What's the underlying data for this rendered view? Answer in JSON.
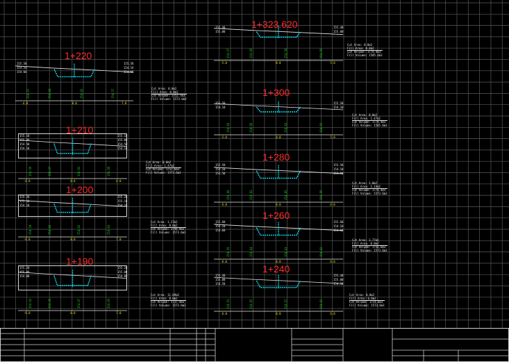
{
  "drawing": {
    "background": "#000000",
    "grid_color": "#5a5a5a",
    "title_color": "#ff2a2a",
    "profile_color": "#00e5ff",
    "label_color": "#19d219",
    "axis_color": "#e6e600"
  },
  "sections": [
    {
      "station": "1+220",
      "elev_left": [
        "155.58",
        "154.54",
        "154.66"
      ],
      "elev_right": [
        "155.58",
        "154.54",
        "154.66"
      ],
      "labels": [
        "154.57",
        "154.64",
        "154.62",
        "154.57"
      ],
      "axis": [
        "-4.0",
        "0.0",
        "7.0"
      ],
      "info": [
        "Cut Area: 0.0m2",
        "Fill Area: 0.0m2",
        "Cut Volume: 1752.7m3",
        "Fill Volume: 1573.6m3"
      ]
    },
    {
      "station": "1+210",
      "elev_left": [
        "155.10",
        "155.00",
        "154.50",
        "154.10"
      ],
      "elev_right": [
        "155.10",
        "155.00",
        "154.50",
        "154.10"
      ],
      "labels": [
        "154.50",
        "154.57",
        "154.62",
        "154.60"
      ],
      "axis": [
        "-6.0",
        "0.0",
        "6.0"
      ],
      "info": [
        "Cut Area: 0.0m2",
        "Fill Area: 1.47m2",
        "Cut Volume: 1752.6m3",
        "Fill Volume: 1573.6m3"
      ]
    },
    {
      "station": "1+200",
      "elev_left": [
        "155.20",
        "155.10",
        "154.10"
      ],
      "elev_right": [
        "155.20",
        "155.10",
        "154.10"
      ],
      "labels": [
        "154.54",
        "154.60",
        "154.62",
        "154.63"
      ],
      "axis": [
        "-6.0",
        "0.0",
        "7.0"
      ],
      "info": [
        "Cut Area: 1.27m2",
        "Fill Area: 0.0m2",
        "Cut Volume: 1749.9m3",
        "Fill Volume: 1573.6m3"
      ]
    },
    {
      "station": "1+190",
      "elev_left": [
        "155.20",
        "155.00",
        "154.80"
      ],
      "elev_right": [
        "155.20",
        "155.00",
        "154.80"
      ],
      "labels": [
        "154.62",
        "154.60",
        "154.67",
        "154.65"
      ],
      "axis": [
        "-6.0",
        "0.0",
        "7.0"
      ],
      "info": [
        "Cut Area: 11.09m2",
        "Fill Area: 0.0m2",
        "Cut Volume: 1737.4m3",
        "Fill Volume: 1573.6m3"
      ]
    },
    {
      "station": "1+323.620",
      "elev_left": [
        "155.40",
        "155.00"
      ],
      "elev_right": [
        "155.40",
        "155.00"
      ],
      "labels": [
        "154.57",
        "154.60",
        "154.59",
        "154.55"
      ],
      "axis": [
        "-5.0",
        "0.0",
        "5.0"
      ],
      "info": [
        "Cut Area: 0.0m2",
        "Fill Area: 0.0m2",
        "Cut Volume: 1774.4m3",
        "Fill Volume: 1585.6m3"
      ]
    },
    {
      "station": "1+300",
      "elev_left": [
        "155.50",
        "154.10"
      ],
      "elev_right": [
        "155.50",
        "154.10"
      ],
      "labels": [
        "154.60",
        "154.60",
        "154.63",
        "154.55"
      ],
      "axis": [
        "-5.0",
        "0.0",
        "5.0"
      ],
      "info": [
        "Cut Area: 0.0m2",
        "Fill Area: 1.47m2",
        "Cut Volume: 1774.4m3",
        "Fill Volume: 1585.6m3"
      ]
    },
    {
      "station": "1+280",
      "elev_left": [
        "155.50",
        "154.10",
        "153.50"
      ],
      "elev_right": [
        "155.50",
        "154.10",
        "153.50"
      ],
      "labels": [
        "154.60",
        "154.63",
        "154.65",
        "154.55"
      ],
      "axis": [
        "-6.0",
        "0.0",
        "6.0"
      ],
      "info": [
        "Cut Area: 1.0m2",
        "Fill Area: 1.14m2",
        "Cut Volume: 1774.4m3",
        "Fill Volume: 1573.6m3"
      ]
    },
    {
      "station": "1+260",
      "elev_left": [
        "155.60",
        "154.10",
        "154.60"
      ],
      "elev_right": [
        "155.60",
        "154.10",
        "154.60"
      ],
      "labels": [
        "154.59",
        "154.64",
        "154.63",
        "154.62"
      ],
      "axis": [
        "-6.0",
        "0.0",
        "6.0"
      ],
      "info": [
        "Cut Area: 1.77m2",
        "Fill Area: 0.0m2",
        "Cut Volume: 1756.6m3",
        "Fill Volume: 1573.6m3"
      ]
    },
    {
      "station": "1+240",
      "elev_left": [
        "155.40",
        "155.00",
        "154.50"
      ],
      "elev_right": [
        "155.40",
        "155.00",
        "154.50"
      ],
      "labels": [
        "154.53",
        "154.65",
        "154.57",
        "154.62"
      ],
      "axis": [
        "-6.0",
        "0.0",
        "6.0"
      ],
      "info": [
        "Cut Area: 0.0m2",
        "Fill Area: 0.0m2",
        "Cut Volume: 1754.6m3",
        "Fill Volume: 1573.6m3"
      ]
    }
  ]
}
